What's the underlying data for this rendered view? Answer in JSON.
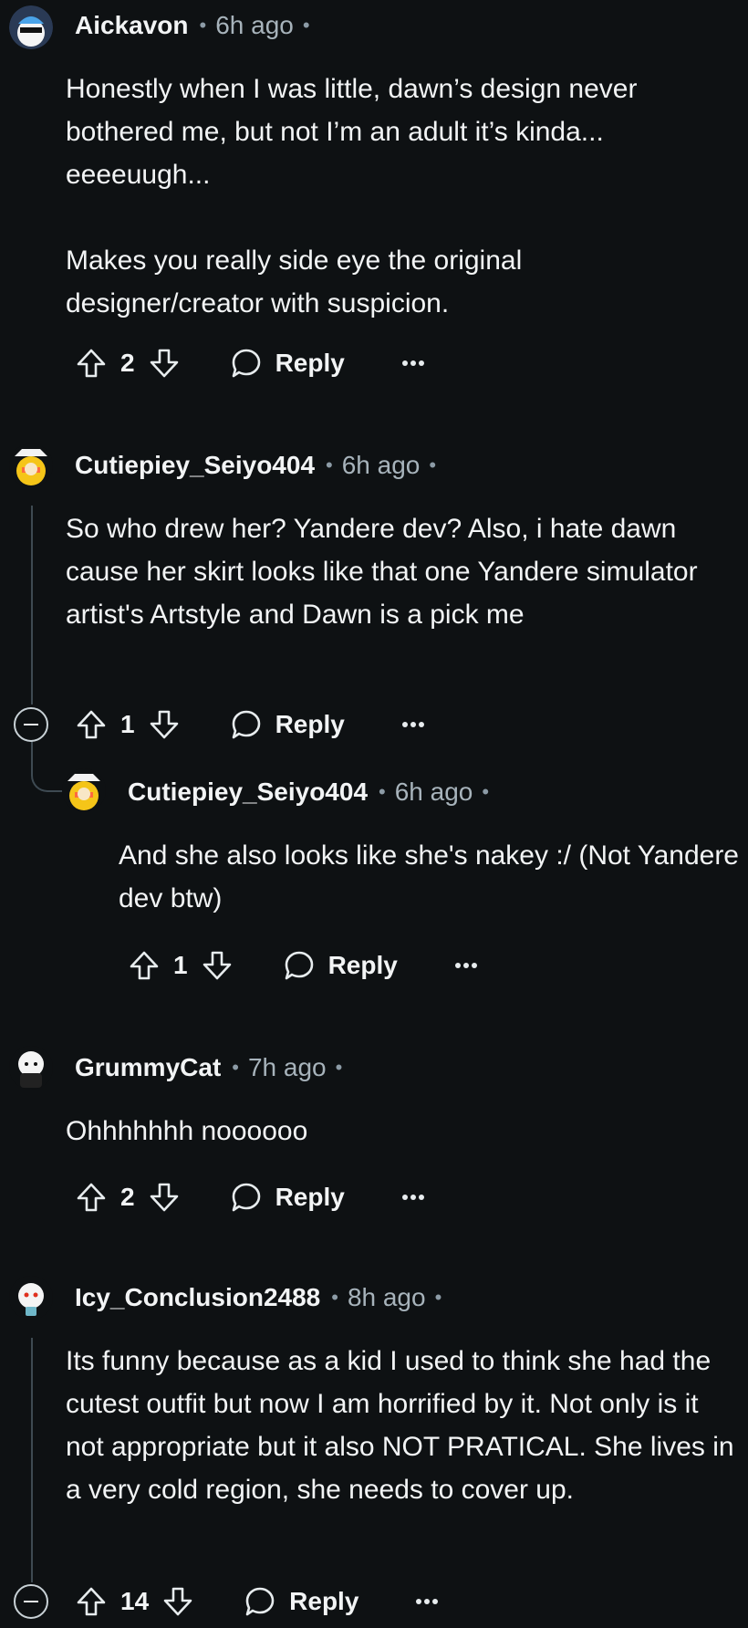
{
  "comments": [
    {
      "author": "Aickavon",
      "time": "6h ago",
      "paragraphs": [
        "Honestly when I was little, dawn’s design never bothered me, but not I’m an adult it’s kinda... eeeeuugh...",
        "Makes you really side eye the original designer/creator with suspicion."
      ],
      "votes": "2",
      "reply_label": "Reply"
    },
    {
      "author": "Cutiepiey_Seiyo404",
      "time": "6h ago",
      "paragraphs": [
        "So who drew her? Yandere dev? Also, i hate dawn cause her skirt looks like that one Yandere simulator artist's Artstyle and Dawn is a pick me"
      ],
      "votes": "1",
      "reply_label": "Reply"
    },
    {
      "author": "Cutiepiey_Seiyo404",
      "time": "6h ago",
      "paragraphs": [
        "And she also looks like she's nakey :/ (Not Yandere dev btw)"
      ],
      "votes": "1",
      "reply_label": "Reply"
    },
    {
      "author": "GrummyCat",
      "time": "7h ago",
      "paragraphs": [
        "Ohhhhhhh noooooo"
      ],
      "votes": "2",
      "reply_label": "Reply"
    },
    {
      "author": "Icy_Conclusion2488",
      "time": "8h ago",
      "paragraphs": [
        "Its funny because as a kid I used to think she had the cutest outfit but now I am horrified by it. Not only is it not appropriate but it also NOT PRATICAL. She lives in a very cold region, she needs to cover up."
      ],
      "votes": "14",
      "reply_label": "Reply"
    }
  ],
  "icons": {
    "upvote": "arrow-up-outline-icon",
    "downvote": "arrow-down-outline-icon",
    "reply": "speech-bubble-icon",
    "more": "ellipsis-icon",
    "collapse": "collapse-minus-icon"
  },
  "colors": {
    "background": "#0e1113",
    "text": "#f2f4f5",
    "meta": "#a7b3bb",
    "thread_line": "#3e4a52"
  }
}
